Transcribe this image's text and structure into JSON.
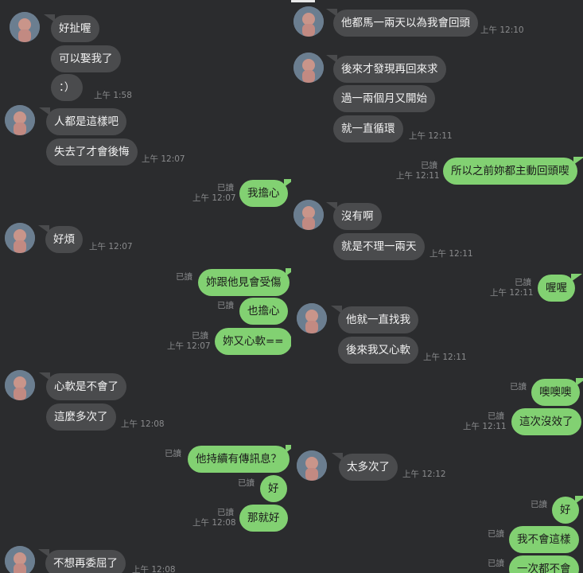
{
  "colors": {
    "background": "#2b2c2e",
    "incoming": "#4a4b4d",
    "outgoing": "#82d172",
    "meta": "#8a8b8d"
  },
  "left_messages": [
    {
      "id": "l1",
      "dir": "in",
      "text": "好扯喔"
    },
    {
      "id": "l2",
      "dir": "in",
      "text": "可以娶我了"
    },
    {
      "id": "l3",
      "dir": "in",
      "text": "：）",
      "time": "上午 1:58"
    },
    {
      "id": "l4",
      "dir": "in",
      "text": "人都是這樣吧"
    },
    {
      "id": "l5",
      "dir": "in",
      "text": "失去了才會後悔",
      "time": "上午 12:07"
    },
    {
      "id": "l6",
      "dir": "out",
      "text": "我擔心",
      "read": "已讀",
      "time": "上午 12:07"
    },
    {
      "id": "l7",
      "dir": "in",
      "text": "好煩",
      "time": "上午 12:07"
    },
    {
      "id": "l8",
      "dir": "out",
      "text": "妳跟他見會受傷",
      "read": "已讀"
    },
    {
      "id": "l9",
      "dir": "out",
      "text": "也擔心",
      "read": "已讀"
    },
    {
      "id": "l10",
      "dir": "out",
      "text": "妳又心軟==",
      "read": "已讀",
      "time": "上午 12:07"
    },
    {
      "id": "l11",
      "dir": "in",
      "text": "心軟是不會了"
    },
    {
      "id": "l12",
      "dir": "in",
      "text": "這麼多次了",
      "time": "上午 12:08"
    },
    {
      "id": "l13",
      "dir": "out",
      "text": "他持續有傳訊息？",
      "read": "已讀"
    },
    {
      "id": "l14",
      "dir": "out",
      "text": "好",
      "read": "已讀"
    },
    {
      "id": "l15",
      "dir": "out",
      "text": "那就好",
      "read": "已讀",
      "time": "上午 12:08"
    },
    {
      "id": "l16",
      "dir": "in",
      "text": "不想再委屈了",
      "time": "上午 12:08"
    }
  ],
  "right_messages": [
    {
      "id": "r1",
      "dir": "in",
      "text": "他都馬一兩天以為我會回頭",
      "time": "上午 12:10"
    },
    {
      "id": "r2",
      "dir": "in",
      "text": "後來才發現再回來求"
    },
    {
      "id": "r3",
      "dir": "in",
      "text": "過一兩個月又開始"
    },
    {
      "id": "r4",
      "dir": "in",
      "text": "就一直循環",
      "time": "上午 12:11"
    },
    {
      "id": "r5",
      "dir": "out",
      "text": "所以之前妳都主動回頭喫",
      "read": "已讀",
      "time": "上午 12:11"
    },
    {
      "id": "r6",
      "dir": "in",
      "text": "沒有啊"
    },
    {
      "id": "r7",
      "dir": "in",
      "text": "就是不理一兩天",
      "time": "上午 12:11"
    },
    {
      "id": "r8",
      "dir": "out",
      "text": "喔喔",
      "read": "已讀",
      "time": "上午 12:11"
    },
    {
      "id": "r9",
      "dir": "in",
      "text": "他就一直找我"
    },
    {
      "id": "r10",
      "dir": "in",
      "text": "後來我又心軟",
      "time": "上午 12:11"
    },
    {
      "id": "r11",
      "dir": "out",
      "text": "噢噢噢",
      "read": "已讀"
    },
    {
      "id": "r12",
      "dir": "out",
      "text": "這次沒效了",
      "read": "已讀",
      "time": "上午 12:11"
    },
    {
      "id": "r13",
      "dir": "in",
      "text": "太多次了",
      "time": "上午 12:12"
    },
    {
      "id": "r14",
      "dir": "out",
      "text": "好",
      "read": "已讀"
    },
    {
      "id": "r15",
      "dir": "out",
      "text": "我不會這樣",
      "read": "已讀"
    },
    {
      "id": "r16",
      "dir": "out",
      "text": "一次都不會",
      "read": "已讀"
    }
  ]
}
